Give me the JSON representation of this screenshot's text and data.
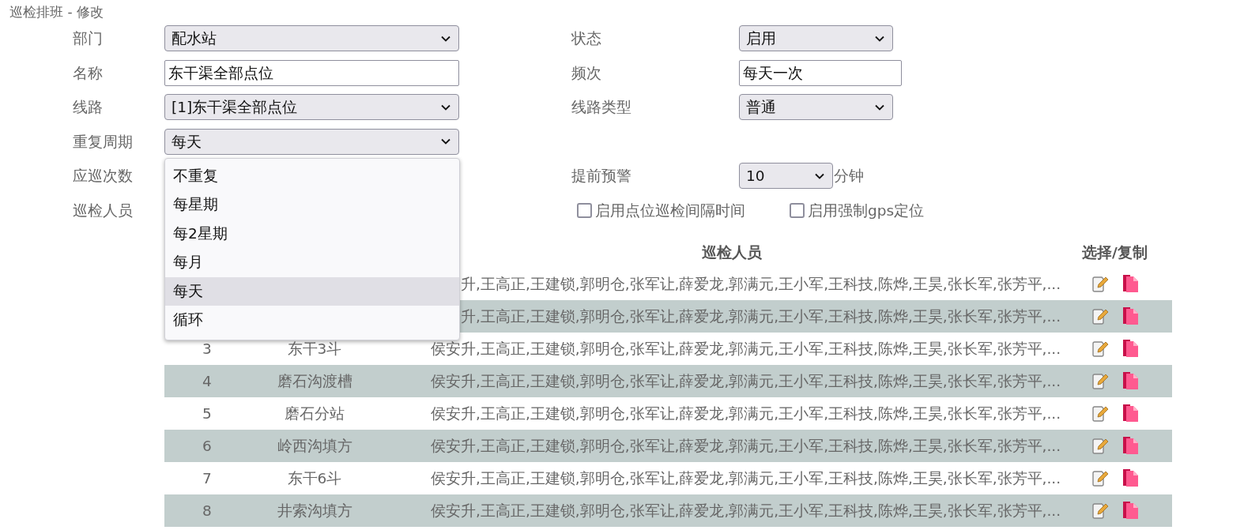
{
  "title": "巡检排班 - 修改",
  "form_rows": [
    {
      "left": {
        "label": "部门",
        "field": {
          "kind": "select",
          "value": "配水站"
        }
      },
      "right": {
        "label": "状态",
        "field": {
          "kind": "select",
          "value": "启用"
        }
      }
    },
    {
      "left": {
        "label": "名称",
        "field": {
          "kind": "input",
          "value": "东干渠全部点位"
        }
      },
      "right": {
        "label": "频次",
        "field": {
          "kind": "input",
          "value": "每天一次"
        }
      }
    },
    {
      "left": {
        "label": "线路",
        "field": {
          "kind": "select",
          "value": "[1]东干渠全部点位"
        }
      },
      "right": {
        "label": "线路类型",
        "field": {
          "kind": "select",
          "value": "普通"
        }
      }
    },
    {
      "left": {
        "label": "重复周期",
        "field": {
          "kind": "select",
          "value": "每天",
          "options": [
            {
              "label": "不重复",
              "selected": false
            },
            {
              "label": "每星期",
              "selected": false
            },
            {
              "label": "每2星期",
              "selected": false
            },
            {
              "label": "每月",
              "selected": false
            },
            {
              "label": "每天",
              "selected": true
            },
            {
              "label": "循环",
              "selected": false
            }
          ]
        }
      }
    },
    {
      "left": {
        "label": "应巡次数"
      },
      "right": {
        "label": "提前预警",
        "field": {
          "kind": "small-select",
          "value": "10",
          "suffix": "分钟"
        }
      }
    },
    {
      "left": {
        "label": "巡检人员"
      },
      "checkboxes": [
        {
          "label": "启用点位巡检间隔时间",
          "checked": false
        },
        {
          "label": "启用强制gps定位",
          "checked": false
        }
      ]
    }
  ],
  "table": {
    "column_3": "巡检人员",
    "column_4": "选择/复制",
    "rows": [
      {
        "persons": "升,王高正,王建锁,郭明仓,张军让,薛爱龙,郭满元,王小军,王科技,陈烨,王昊,张长军,张芳平,..."
      },
      {
        "persons": "升,王高正,王建锁,郭明仓,张军让,薛爱龙,郭满元,王小军,王科技,陈烨,王昊,张长军,张芳平,..."
      },
      {
        "index": "3",
        "name": "东干3斗",
        "persons": "侯安升,王高正,王建锁,郭明仓,张军让,薛爱龙,郭满元,王小军,王科技,陈烨,王昊,张长军,张芳平,..."
      },
      {
        "index": "4",
        "name": "磨石沟渡槽",
        "persons": "侯安升,王高正,王建锁,郭明仓,张军让,薛爱龙,郭满元,王小军,王科技,陈烨,王昊,张长军,张芳平,..."
      },
      {
        "index": "5",
        "name": "磨石分站",
        "persons": "侯安升,王高正,王建锁,郭明仓,张军让,薛爱龙,郭满元,王小军,王科技,陈烨,王昊,张长军,张芳平,..."
      },
      {
        "index": "6",
        "name": "岭西沟填方",
        "persons": "侯安升,王高正,王建锁,郭明仓,张军让,薛爱龙,郭满元,王小军,王科技,陈烨,王昊,张长军,张芳平,..."
      },
      {
        "index": "7",
        "name": "东干6斗",
        "persons": "侯安升,王高正,王建锁,郭明仓,张军让,薛爱龙,郭满元,王小军,王科技,陈烨,王昊,张长军,张芳平,..."
      },
      {
        "index": "8",
        "name": "井索沟填方",
        "persons": "侯安升,王高正,王建锁,郭明仓,张军让,薛爱龙,郭满元,王小军,王科技,陈烨,王昊,张长军,张芳平,..."
      }
    ]
  }
}
